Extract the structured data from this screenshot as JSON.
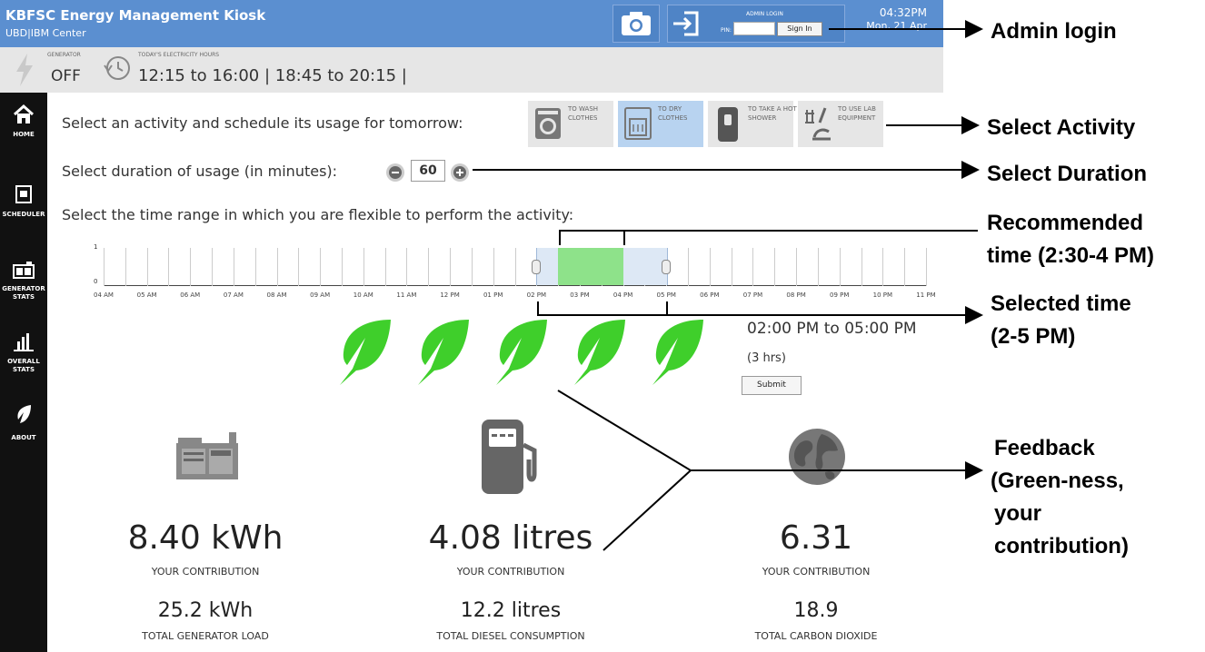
{
  "header": {
    "title": "KBFSC Energy Management Kiosk",
    "subtitle_a": "UBD",
    "subtitle_sep": "|",
    "subtitle_b": "IBM Center",
    "admin_login_label": "ADMIN LOGIN",
    "pin_label": "PIN:",
    "pin_value": "",
    "sign_in": "Sign In",
    "time": "04:32PM",
    "date": "Mon, 21 Apr"
  },
  "infobar": {
    "generator_label": "GENERATOR",
    "generator_value": "OFF",
    "hours_label": "TODAY'S ELECTRICITY HOURS",
    "hours_value": "12:15 to 16:00 | 18:45 to 20:15 |"
  },
  "sidebar": {
    "items": [
      {
        "label": "HOME",
        "icon": "home-icon"
      },
      {
        "label": "SCHEDULER",
        "icon": "scheduler-icon"
      },
      {
        "label": "GENERATOR STATS",
        "icon": "generator-icon"
      },
      {
        "label": "OVERALL STATS",
        "icon": "bar-chart-icon"
      },
      {
        "label": "ABOUT",
        "icon": "leaf-icon"
      }
    ]
  },
  "main": {
    "activity_prompt": "Select an activity and schedule its usage for tomorrow:",
    "activities": [
      {
        "label": "TO WASH CLOTHES",
        "icon": "washing-machine-icon",
        "selected": false
      },
      {
        "label": "TO DRY CLOTHES",
        "icon": "dryer-icon",
        "selected": true
      },
      {
        "label": "TO TAKE A HOT SHOWER",
        "icon": "water-heater-icon",
        "selected": false
      },
      {
        "label": "TO USE LAB EQUIPMENT",
        "icon": "microscope-icon",
        "selected": false
      }
    ],
    "duration_prompt": "Select duration of usage (in minutes):",
    "duration_value": "60",
    "range_prompt": "Select the time range in which you are flexible to perform the activity:",
    "timeline": {
      "y_top_label": "1",
      "y_bottom_label": "0",
      "hours": [
        "04 AM",
        "05 AM",
        "06 AM",
        "07 AM",
        "08 AM",
        "09 AM",
        "10 AM",
        "11 AM",
        "12 PM",
        "01 PM",
        "02 PM",
        "03 PM",
        "04 PM",
        "05 PM",
        "06 PM",
        "07 PM",
        "08 PM",
        "09 PM",
        "10 PM",
        "11 PM"
      ],
      "selected_start_hour": 14,
      "selected_end_hour": 17,
      "recommended_start_hour": 14.5,
      "recommended_end_hour": 16,
      "selected_color": "#dde8f5",
      "recommended_color": "#8ee28a"
    },
    "green_leaves": 5,
    "leaf_color": "#3fcf2b",
    "selected_range_text": "02:00 PM to 05:00 PM",
    "selected_hours_text": "(3 hrs)",
    "submit_label": "Submit"
  },
  "stats": [
    {
      "icon": "generator-icon",
      "contribution": "8.40 kWh",
      "contribution_label": "YOUR CONTRIBUTION",
      "total": "25.2 kWh",
      "total_label": "TOTAL GENERATOR LOAD"
    },
    {
      "icon": "fuel-pump-icon",
      "contribution": "4.08 litres",
      "contribution_label": "YOUR CONTRIBUTION",
      "total": "12.2 litres",
      "total_label": "TOTAL DIESEL CONSUMPTION"
    },
    {
      "icon": "globe-icon",
      "contribution": "6.31",
      "contribution_label": "YOUR CONTRIBUTION",
      "total": "18.9",
      "total_label": "TOTAL CARBON DIOXIDE"
    }
  ],
  "annotations": {
    "admin_login": "Admin login",
    "select_activity": "Select Activity",
    "select_duration": "Select Duration",
    "recommended_time_1": "Recommended",
    "recommended_time_2": "time (2:30-4 PM)",
    "selected_time_1": "Selected time",
    "selected_time_2": "(2-5 PM)",
    "feedback_1": "Feedback",
    "feedback_2": "(Green-ness,",
    "feedback_3": "your",
    "feedback_4": "contribution)"
  }
}
